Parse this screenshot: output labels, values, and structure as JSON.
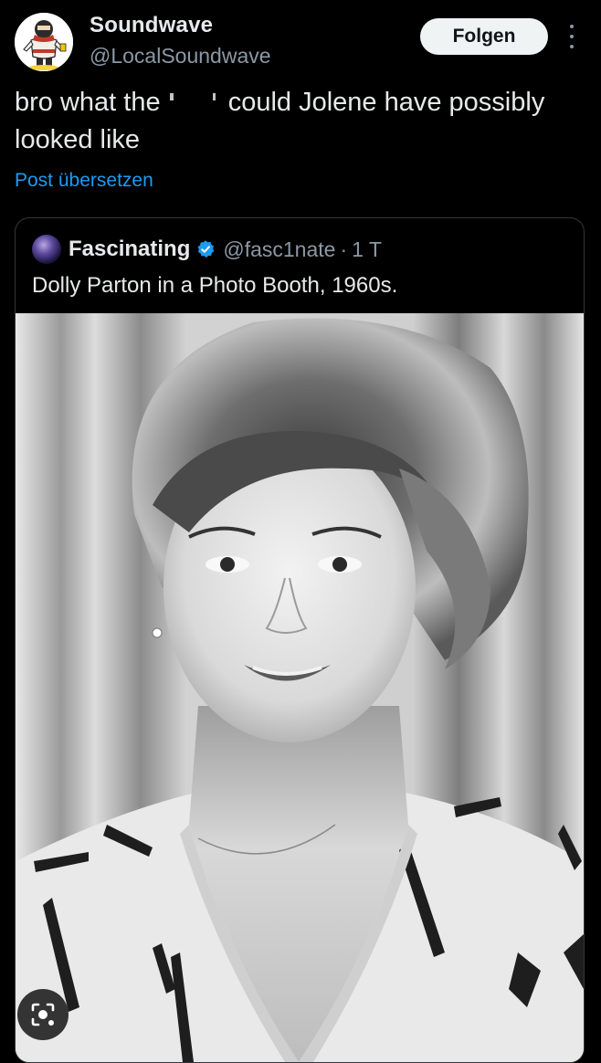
{
  "post": {
    "author": {
      "display_name": "Soundwave",
      "handle": "@LocalSoundwave",
      "avatar_icon": "cartoon-character-avatar"
    },
    "follow_label": "Folgen",
    "text_before": "bro what the ",
    "text_censored_icon": "censored-word",
    "text_after": " could Jolene have possibly looked like",
    "translate_label": "Post übersetzen"
  },
  "quote": {
    "author": {
      "display_name": "Fascinating",
      "handle": "@fasc1nate",
      "separator": "·",
      "time": "1 T",
      "verified": true,
      "avatar_icon": "galaxy-avatar"
    },
    "text": "Dolly Parton in a Photo Booth, 1960s.",
    "image": {
      "subject_icon": "black-and-white-portrait-photo"
    }
  },
  "overlay": {
    "lens_icon": "image-search-icon"
  },
  "colors": {
    "background": "#000000",
    "text_primary": "#e7e9ea",
    "text_secondary": "#8b98a5",
    "link": "#1d9bf0",
    "follow_bg": "#eff3f4",
    "border": "#333639"
  }
}
